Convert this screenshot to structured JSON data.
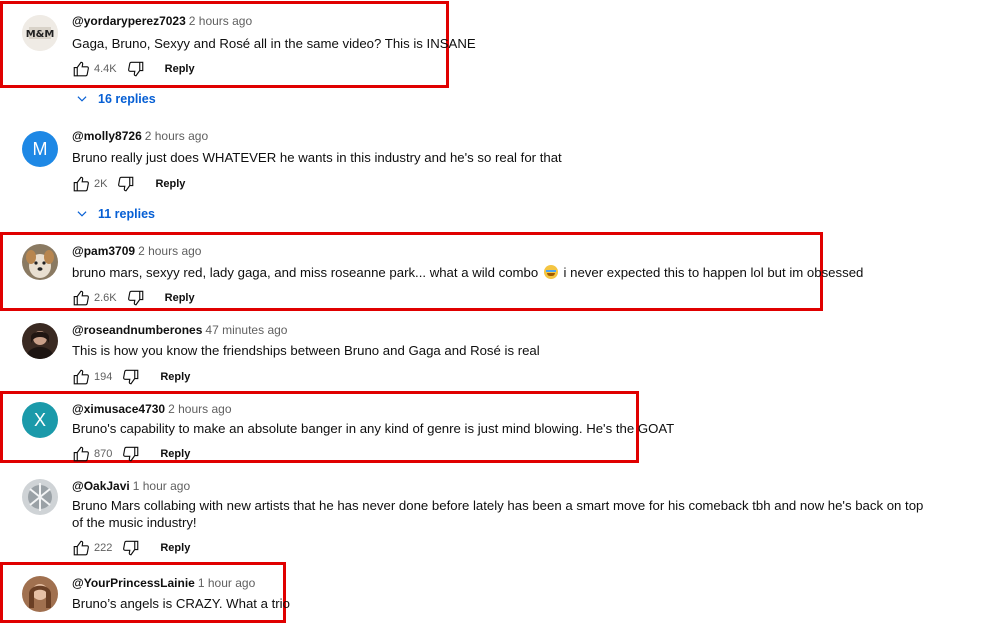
{
  "comments": [
    {
      "author": "@yordaryperez7023",
      "time": "2 hours ago",
      "text": "Gaga, Bruno, Sexyy and Rosé all in the same video? This is INSANE",
      "likes": "4.4K",
      "reply": "Reply",
      "replies": "16 replies",
      "avatar": "logo-avatar",
      "avatar_text": "M&M"
    },
    {
      "author": "@molly8726",
      "time": "2 hours ago",
      "text": "Bruno really just does WHATEVER he wants in this industry and he's so real for that",
      "likes": "2K",
      "reply": "Reply",
      "replies": "11 replies",
      "avatar": "letter",
      "avatar_letter": "M",
      "avatar_color": "#1e88e5"
    },
    {
      "author": "@pam3709",
      "time": "2 hours ago",
      "text_before": "bruno mars, sexyy red, lady gaga, and miss roseanne park... what a wild combo",
      "emoji": "crying-face-emoji",
      "text_after": "i never expected this to happen lol but im obsessed",
      "likes": "2.6K",
      "reply": "Reply",
      "avatar": "dog-photo"
    },
    {
      "author": "@roseandnumberones",
      "time": "47 minutes ago",
      "text": "This is how you know the friendships between Bruno and Gaga and Rosé is real",
      "likes": "194",
      "reply": "Reply",
      "avatar": "person-photo"
    },
    {
      "author": "@ximusace4730",
      "time": "2 hours ago",
      "text": "Bruno's capability to make an absolute banger in any kind of genre is just mind blowing. He's the GOAT",
      "likes": "870",
      "reply": "Reply",
      "avatar": "letter",
      "avatar_letter": "X",
      "avatar_color": "#1b9aaa"
    },
    {
      "author": "@OakJavi",
      "time": "1 hour ago",
      "text": "Bruno Mars collabing with new artists that he has never done before lately has been a smart move for his comeback tbh and now he's back on top of the music industry!",
      "likes": "222",
      "reply": "Reply",
      "avatar": "abstract-photo"
    },
    {
      "author": "@YourPrincessLainie",
      "time": "1 hour ago",
      "text": "Bruno’s angels is CRAZY. What a trio",
      "avatar": "person-photo"
    }
  ],
  "colors": {
    "highlight": "#e00000",
    "link": "#065fd4",
    "meta": "#606060"
  }
}
